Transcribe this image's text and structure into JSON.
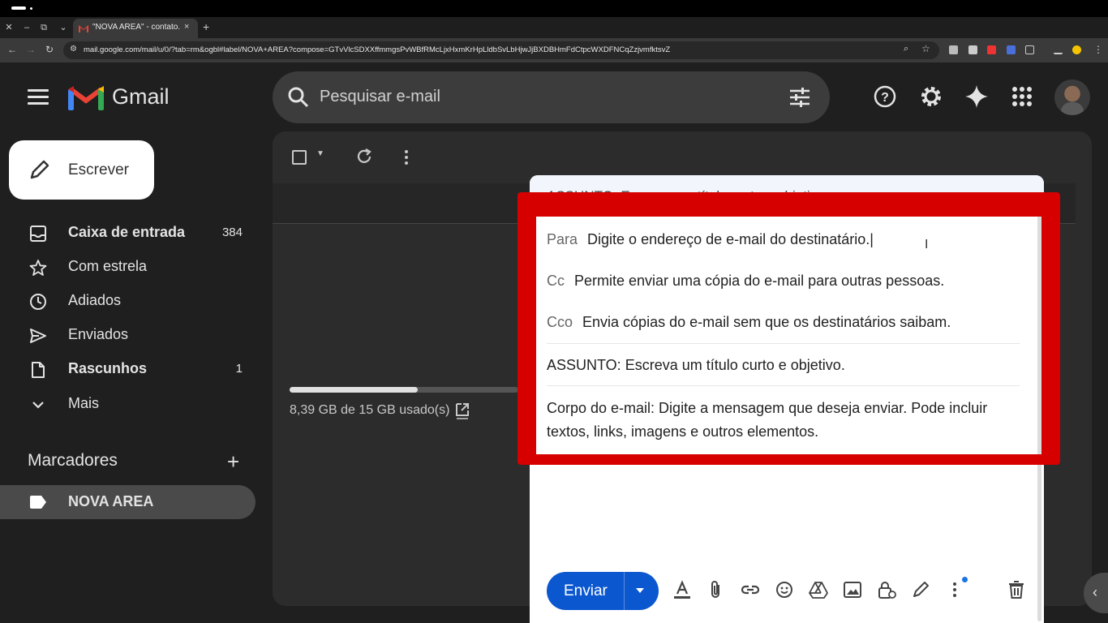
{
  "browser": {
    "tab_title": "\"NOVA AREA\" - contato.",
    "url": "mail.google.com/mail/u/0/?tab=rm&ogbl#label/NOVA+AREA?compose=GTvVlcSDXXffmmgsPvWBfRMcLjxHxmKrHpLldbSvLbHjwJjBXDBHmFdCtpcWXDFNCqZzjvmfktsvZ",
    "new_tab_label": "+",
    "close_tab_label": "×"
  },
  "gmail": {
    "brand": "Gmail",
    "search_placeholder": "Pesquisar e-mail"
  },
  "sidebar": {
    "compose_label": "Escrever",
    "items": [
      {
        "label": "Caixa de entrada",
        "count": "384",
        "bold": true,
        "icon": "inbox-icon"
      },
      {
        "label": "Com estrela",
        "count": "",
        "bold": false,
        "icon": "star-icon"
      },
      {
        "label": "Adiados",
        "count": "",
        "bold": false,
        "icon": "clock-icon"
      },
      {
        "label": "Enviados",
        "count": "",
        "bold": false,
        "icon": "send-icon"
      },
      {
        "label": "Rascunhos",
        "count": "1",
        "bold": true,
        "icon": "draft-icon"
      },
      {
        "label": "Mais",
        "count": "",
        "bold": false,
        "icon": "chevron-down-icon"
      }
    ],
    "labels_title": "Marcadores",
    "labels_add": "+",
    "label_items": [
      {
        "label": "NOVA AREA",
        "icon": "label-icon"
      }
    ]
  },
  "storage": {
    "text": "8,39 GB de 15 GB usado(s)",
    "fraction_used": 0.56
  },
  "compose": {
    "header_title": "ASSUNTO: Escreva um título curto e objetivo.",
    "to_label": "Para",
    "to_value": "Digite o endereço de e-mail do destinatário.",
    "cc_label": "Cc",
    "cc_value": "Permite enviar uma cópia do e-mail para outras pessoas.",
    "bcc_label": "Cco",
    "bcc_value": "Envia cópias do e-mail sem que os destinatários saibam.",
    "subject": "ASSUNTO: Escreva um título curto e objetivo.",
    "body_line1": "Corpo do e-mail: Digite a mensagem que deseja enviar. Pode incluir",
    "body_line2": "textos, links, imagens e outros elementos.",
    "send_label": "Enviar"
  },
  "colors": {
    "highlight_frame": "#d60000",
    "send_button": "#0b57d0",
    "notification_dot": "#1a73e8"
  }
}
